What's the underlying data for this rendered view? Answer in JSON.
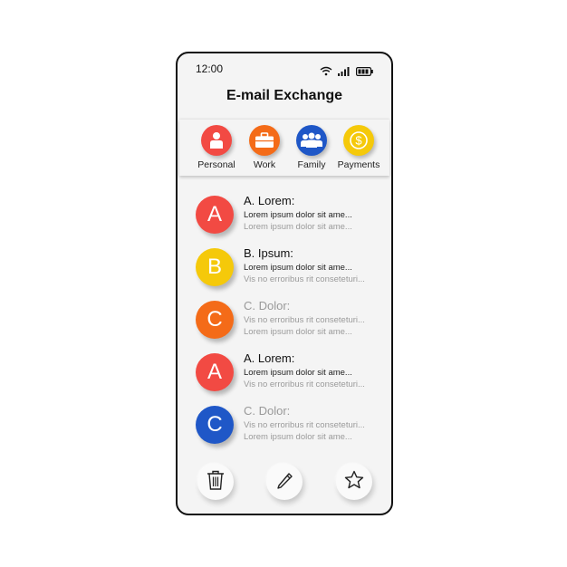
{
  "status_bar": {
    "time": "12:00",
    "icons": [
      "wifi-icon",
      "signal-icon",
      "battery-icon"
    ]
  },
  "app_title": "E-mail Exchange",
  "categories": [
    {
      "label": "Personal",
      "color": "#f24a43",
      "icon": "person-icon"
    },
    {
      "label": "Work",
      "color": "#f46b18",
      "icon": "briefcase-icon"
    },
    {
      "label": "Family",
      "color": "#1f57c7",
      "icon": "group-icon"
    },
    {
      "label": "Payments",
      "color": "#f5c90a",
      "icon": "dollar-icon"
    }
  ],
  "messages": [
    {
      "initial": "A",
      "color": "#f24a43",
      "sender": "A. Lorem:",
      "line1": "Lorem ipsum dolor sit ame...",
      "line2": "Lorem ipsum dolor sit ame...",
      "read": false
    },
    {
      "initial": "B",
      "color": "#f5c90a",
      "sender": "B. Ipsum:",
      "line1": "Lorem ipsum dolor sit ame...",
      "line2": "Vis no erroribus rit conseteturi...",
      "read": false
    },
    {
      "initial": "C",
      "color": "#f46b18",
      "sender": "C. Dolor:",
      "line1": "Vis no erroribus rit conseteturi...",
      "line2": "Lorem ipsum dolor sit ame...",
      "read": true
    },
    {
      "initial": "A",
      "color": "#f24a43",
      "sender": "A. Lorem:",
      "line1": "Lorem ipsum dolor sit ame...",
      "line2": "Vis no erroribus rit conseteturi...",
      "read": false
    },
    {
      "initial": "C",
      "color": "#1f57c7",
      "sender": "C. Dolor:",
      "line1": "Vis no erroribus rit conseteturi...",
      "line2": "Lorem ipsum dolor sit ame...",
      "read": true
    }
  ],
  "actions": [
    "trash-icon",
    "pencil-icon",
    "star-icon"
  ]
}
